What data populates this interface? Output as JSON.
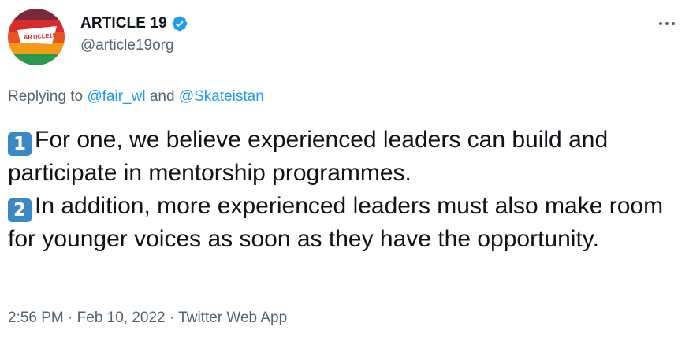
{
  "author": {
    "display_name": "ARTICLE 19",
    "handle": "@article19org",
    "avatar_text": "ARTICLE19"
  },
  "more_icon": "ellipsis-icon",
  "reply": {
    "prefix": "Replying to",
    "mention1": "@fair_wl",
    "joiner": "and",
    "mention2": "@Skateistan"
  },
  "tweet": {
    "point1_number": "1",
    "point1_text": "For one, we believe experienced leaders can build and participate in mentorship programmes.",
    "point2_number": "2",
    "point2_text": "In addition, more experienced leaders must also make room for younger voices as soon as they have the opportunity."
  },
  "meta": {
    "text": "2:56 PM · Feb 10, 2022 · Twitter Web App"
  },
  "colors": {
    "link": "#1d9bf0",
    "secondary": "#536471",
    "keycap": "#3b88c3",
    "verified": "#1d9bf0"
  }
}
